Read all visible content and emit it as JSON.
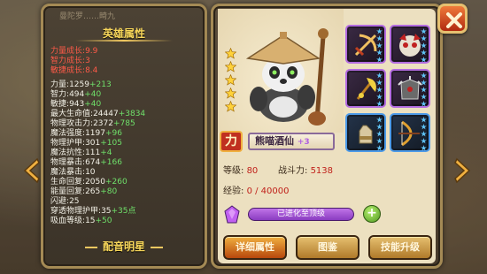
{
  "left_panel": {
    "top_text": "曼陀罗……畸九",
    "title": "英雄属性",
    "growth": [
      {
        "label": "力量成长",
        "value": "9.9"
      },
      {
        "label": "智力成长",
        "value": "3"
      },
      {
        "label": "敏捷成长",
        "value": "8.4"
      }
    ],
    "stats": [
      {
        "label": "力量",
        "value": "1259",
        "bonus": "+213"
      },
      {
        "label": "智力",
        "value": "494",
        "bonus": "+40"
      },
      {
        "label": "敏捷",
        "value": "943",
        "bonus": "+40"
      },
      {
        "label": "最大生命值",
        "value": "24447",
        "bonus": "+3834"
      },
      {
        "label": "物理攻击力",
        "value": "2372",
        "bonus": "+785"
      },
      {
        "label": "魔法强度",
        "value": "1197",
        "bonus": "+96"
      },
      {
        "label": "物理护甲",
        "value": "301",
        "bonus": "+105"
      },
      {
        "label": "魔法抗性",
        "value": "111",
        "bonus": "+4"
      },
      {
        "label": "物理暴击",
        "value": "674",
        "bonus": "+166"
      },
      {
        "label": "魔法暴击",
        "value": "10",
        "bonus": ""
      },
      {
        "label": "生命回复",
        "value": "2050",
        "bonus": "+260"
      },
      {
        "label": "能量回复",
        "value": "265",
        "bonus": "+80"
      },
      {
        "label": "闪避",
        "value": "25",
        "bonus": ""
      },
      {
        "label": "穿透物理护甲",
        "value": "35",
        "bonus": "+35点"
      },
      {
        "label": "吸血等级",
        "value": "15",
        "bonus": "+50"
      }
    ],
    "footer": "配音明星"
  },
  "hero": {
    "stars": 5,
    "power_tag": "力",
    "name": "熊喵酒仙",
    "name_plus": "+3",
    "level_label": "等级:",
    "level": "80",
    "power_label": "战斗力:",
    "power": "5138",
    "exp_label": "经验:",
    "exp": "0 / 40000",
    "evolve_text": "已进化至顶级"
  },
  "equipment": [
    {
      "icon": "crossbow-icon",
      "rarity": "purple",
      "stars": 5
    },
    {
      "icon": "demon-mask-icon",
      "rarity": "purple",
      "stars": 5
    },
    {
      "icon": "golden-axe-icon",
      "rarity": "purple",
      "stars": 5
    },
    {
      "icon": "spiked-armor-icon",
      "rarity": "purple",
      "stars": 5
    },
    {
      "icon": "gauntlet-icon",
      "rarity": "blue",
      "stars": 5
    },
    {
      "icon": "bow-icon",
      "rarity": "blue",
      "stars": 5
    }
  ],
  "buttons": {
    "details": "详细属性",
    "codex": "图鉴",
    "skills": "技能升级"
  },
  "colors": {
    "growth_text": "#ff5a48",
    "bonus_text": "#6fe06a",
    "title_gold": "#f7d65a",
    "purple_frame": "#b36ce0",
    "blue_frame": "#4c9ae8"
  }
}
